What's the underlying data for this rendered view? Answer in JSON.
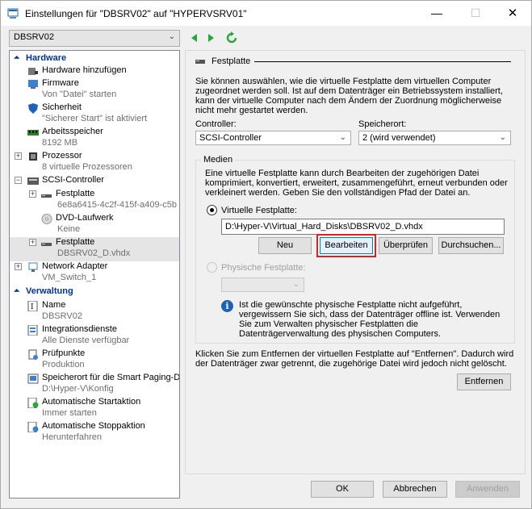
{
  "window": {
    "title": "Einstellungen für \"DBSRV02\" auf \"HYPERVSRV01\"",
    "minimize": "—",
    "maximize": "☐",
    "close": "✕"
  },
  "toolbar": {
    "vm_selected": "DBSRV02"
  },
  "tree": {
    "hardware_label": "Hardware",
    "verwaltung_label": "Verwaltung",
    "items": [
      {
        "name": "Hardware hinzufügen",
        "sub": ""
      },
      {
        "name": "Firmware",
        "sub": "Von \"Datei\" starten"
      },
      {
        "name": "Sicherheit",
        "sub": "\"Sicherer Start\" ist aktiviert"
      },
      {
        "name": "Arbeitsspeicher",
        "sub": "8192 MB"
      },
      {
        "name": "Prozessor",
        "sub": "8 virtuelle Prozessoren"
      },
      {
        "name": "SCSI-Controller",
        "sub": ""
      },
      {
        "name": "Festplatte",
        "sub": "6e8a6415-4c2f-415f-a409-c5b..."
      },
      {
        "name": "DVD-Laufwerk",
        "sub": "Keine"
      },
      {
        "name": "Festplatte",
        "sub": "DBSRV02_D.vhdx"
      },
      {
        "name": "Network Adapter",
        "sub": "VM_Switch_1"
      },
      {
        "name": "Name",
        "sub": "DBSRV02"
      },
      {
        "name": "Integrationsdienste",
        "sub": "Alle Dienste verfügbar"
      },
      {
        "name": "Prüfpunkte",
        "sub": "Produktion"
      },
      {
        "name": "Speicherort für die Smart Paging-D...",
        "sub": "D:\\Hyper-V\\Konfig"
      },
      {
        "name": "Automatische Startaktion",
        "sub": "Immer starten"
      },
      {
        "name": "Automatische Stoppaktion",
        "sub": "Herunterfahren"
      }
    ]
  },
  "detail": {
    "header": "Festplatte",
    "intro": "Sie können auswählen, wie die virtuelle Festplatte dem virtuellen Computer zugeordnet werden soll. Ist auf dem Datenträger ein Betriebssystem installiert, kann der virtuelle Computer nach dem Ändern der Zuordnung möglicherweise nicht mehr gestartet werden.",
    "controller_label": "Controller:",
    "controller_value": "SCSI-Controller",
    "location_label": "Speicherort:",
    "location_value": "2 (wird verwendet)",
    "media_label": "Medien",
    "media_text": "Eine virtuelle Festplatte kann durch Bearbeiten der zugehörigen Datei komprimiert, konvertiert, erweitert, zusammengeführt, erneut verbunden oder verkleinert werden. Geben Sie den vollständigen Pfad der Datei an.",
    "virtual_disk_label": "Virtuelle Festplatte:",
    "virtual_disk_path": "D:\\Hyper-V\\Virtual_Hard_Disks\\DBSRV02_D.vhdx",
    "btn_new": "Neu",
    "btn_edit": "Bearbeiten",
    "btn_check": "Überprüfen",
    "btn_browse": "Durchsuchen...",
    "physical_disk_label": "Physische Festplatte:",
    "info_text": "Ist die gewünschte physische Festplatte nicht aufgeführt, vergewissern Sie sich, dass der Datenträger offline ist. Verwenden Sie zum Verwalten physischer Festplatten die Datenträgerverwaltung des physischen Computers.",
    "remove_text": "Klicken Sie zum Entfernen der virtuellen Festplatte auf \"Entfernen\". Dadurch wird der Datenträger zwar getrennt, die zugehörige Datei wird jedoch nicht gelöscht.",
    "btn_remove": "Entfernen"
  },
  "footer": {
    "ok": "OK",
    "cancel": "Abbrechen",
    "apply": "Anwenden"
  },
  "colors": {
    "section_blue": "#003399",
    "highlight_red": "#d42424",
    "info_blue": "#1c63b8"
  }
}
